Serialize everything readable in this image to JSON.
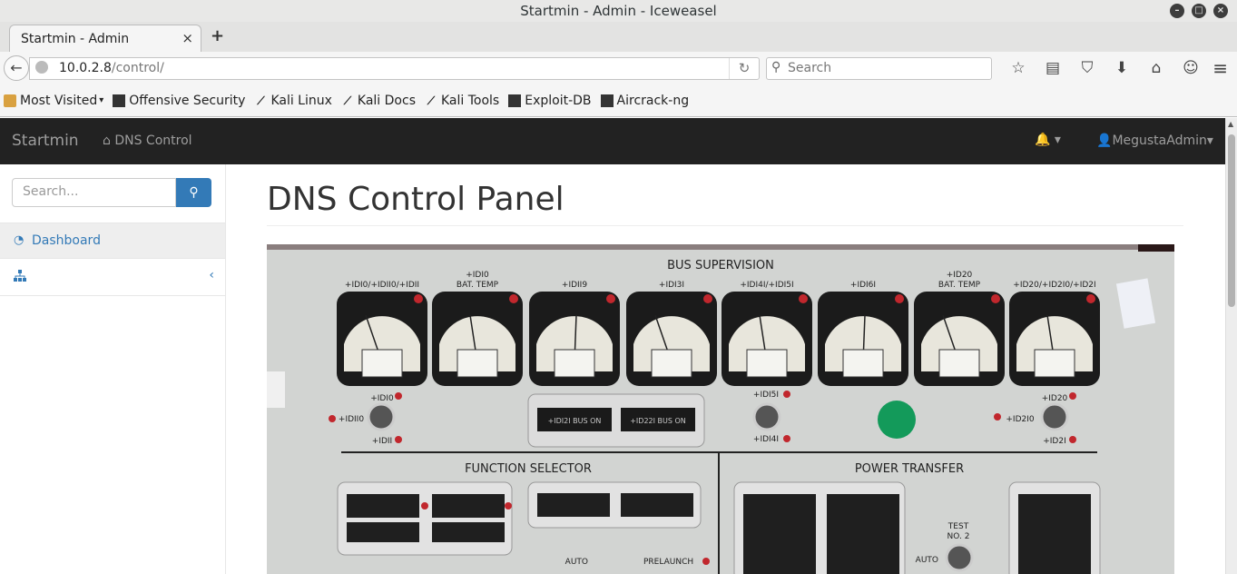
{
  "window": {
    "title": "Startmin - Admin - Iceweasel"
  },
  "tab": {
    "title": "Startmin - Admin",
    "close": "×",
    "new": "+"
  },
  "nav": {
    "url_host": "10.0.2.8",
    "url_path": "/control/",
    "search_placeholder": "Search"
  },
  "bookmarks": [
    {
      "label": "Most Visited",
      "icon": "folder-icon"
    },
    {
      "label": "Offensive Security",
      "icon": "offsec-icon"
    },
    {
      "label": "Kali Linux",
      "icon": "kali-icon"
    },
    {
      "label": "Kali Docs",
      "icon": "kali-icon"
    },
    {
      "label": "Kali Tools",
      "icon": "kali-icon"
    },
    {
      "label": "Exploit-DB",
      "icon": "exploitdb-icon"
    },
    {
      "label": "Aircrack-ng",
      "icon": "aircrack-icon"
    }
  ],
  "app": {
    "brand": "Startmin",
    "nav_link": "DNS Control",
    "user": "MegustaAdmin",
    "sidebar": {
      "search_placeholder": "Search...",
      "items": [
        {
          "label": "Dashboard",
          "icon": "dashboard-icon"
        },
        {
          "label": "",
          "icon": "sitemap-icon"
        }
      ]
    },
    "page_title": "DNS Control Panel"
  },
  "panel_image": {
    "labels": {
      "bus_supervision": "BUS SUPERVISION",
      "function_selector": "FUNCTION SELECTOR",
      "power_transfer": "POWER TRANSFER",
      "test": "TEST",
      "no2": "NO. 2",
      "auto": "AUTO",
      "prelaunch": "PRELAUNCH",
      "idi10": "+IDI0",
      "idi10b": "+IDII0",
      "idi11": "+IDII",
      "idi151": "+IDI5I",
      "idi141": "+IDI4I",
      "idi20": "+ID20",
      "idi210": "+ID2I0",
      "idi21": "+ID2I"
    },
    "gauges": [
      {
        "label": "+IDI0/+IDII0/+IDII",
        "sub": ""
      },
      {
        "label": "+IDI0",
        "sub": "BAT. TEMP"
      },
      {
        "label": "+IDII9",
        "sub": ""
      },
      {
        "label": "+IDI3I",
        "sub": ""
      },
      {
        "label": "+IDI4I/+IDI5I",
        "sub": ""
      },
      {
        "label": "+IDI6I",
        "sub": ""
      },
      {
        "label": "+ID20",
        "sub": "BAT. TEMP"
      },
      {
        "label": "+ID20/+ID2I0/+ID2I",
        "sub": ""
      }
    ],
    "bus_windows": [
      "+IDI2I BUS ON",
      "+ID22I BUS ON"
    ]
  }
}
